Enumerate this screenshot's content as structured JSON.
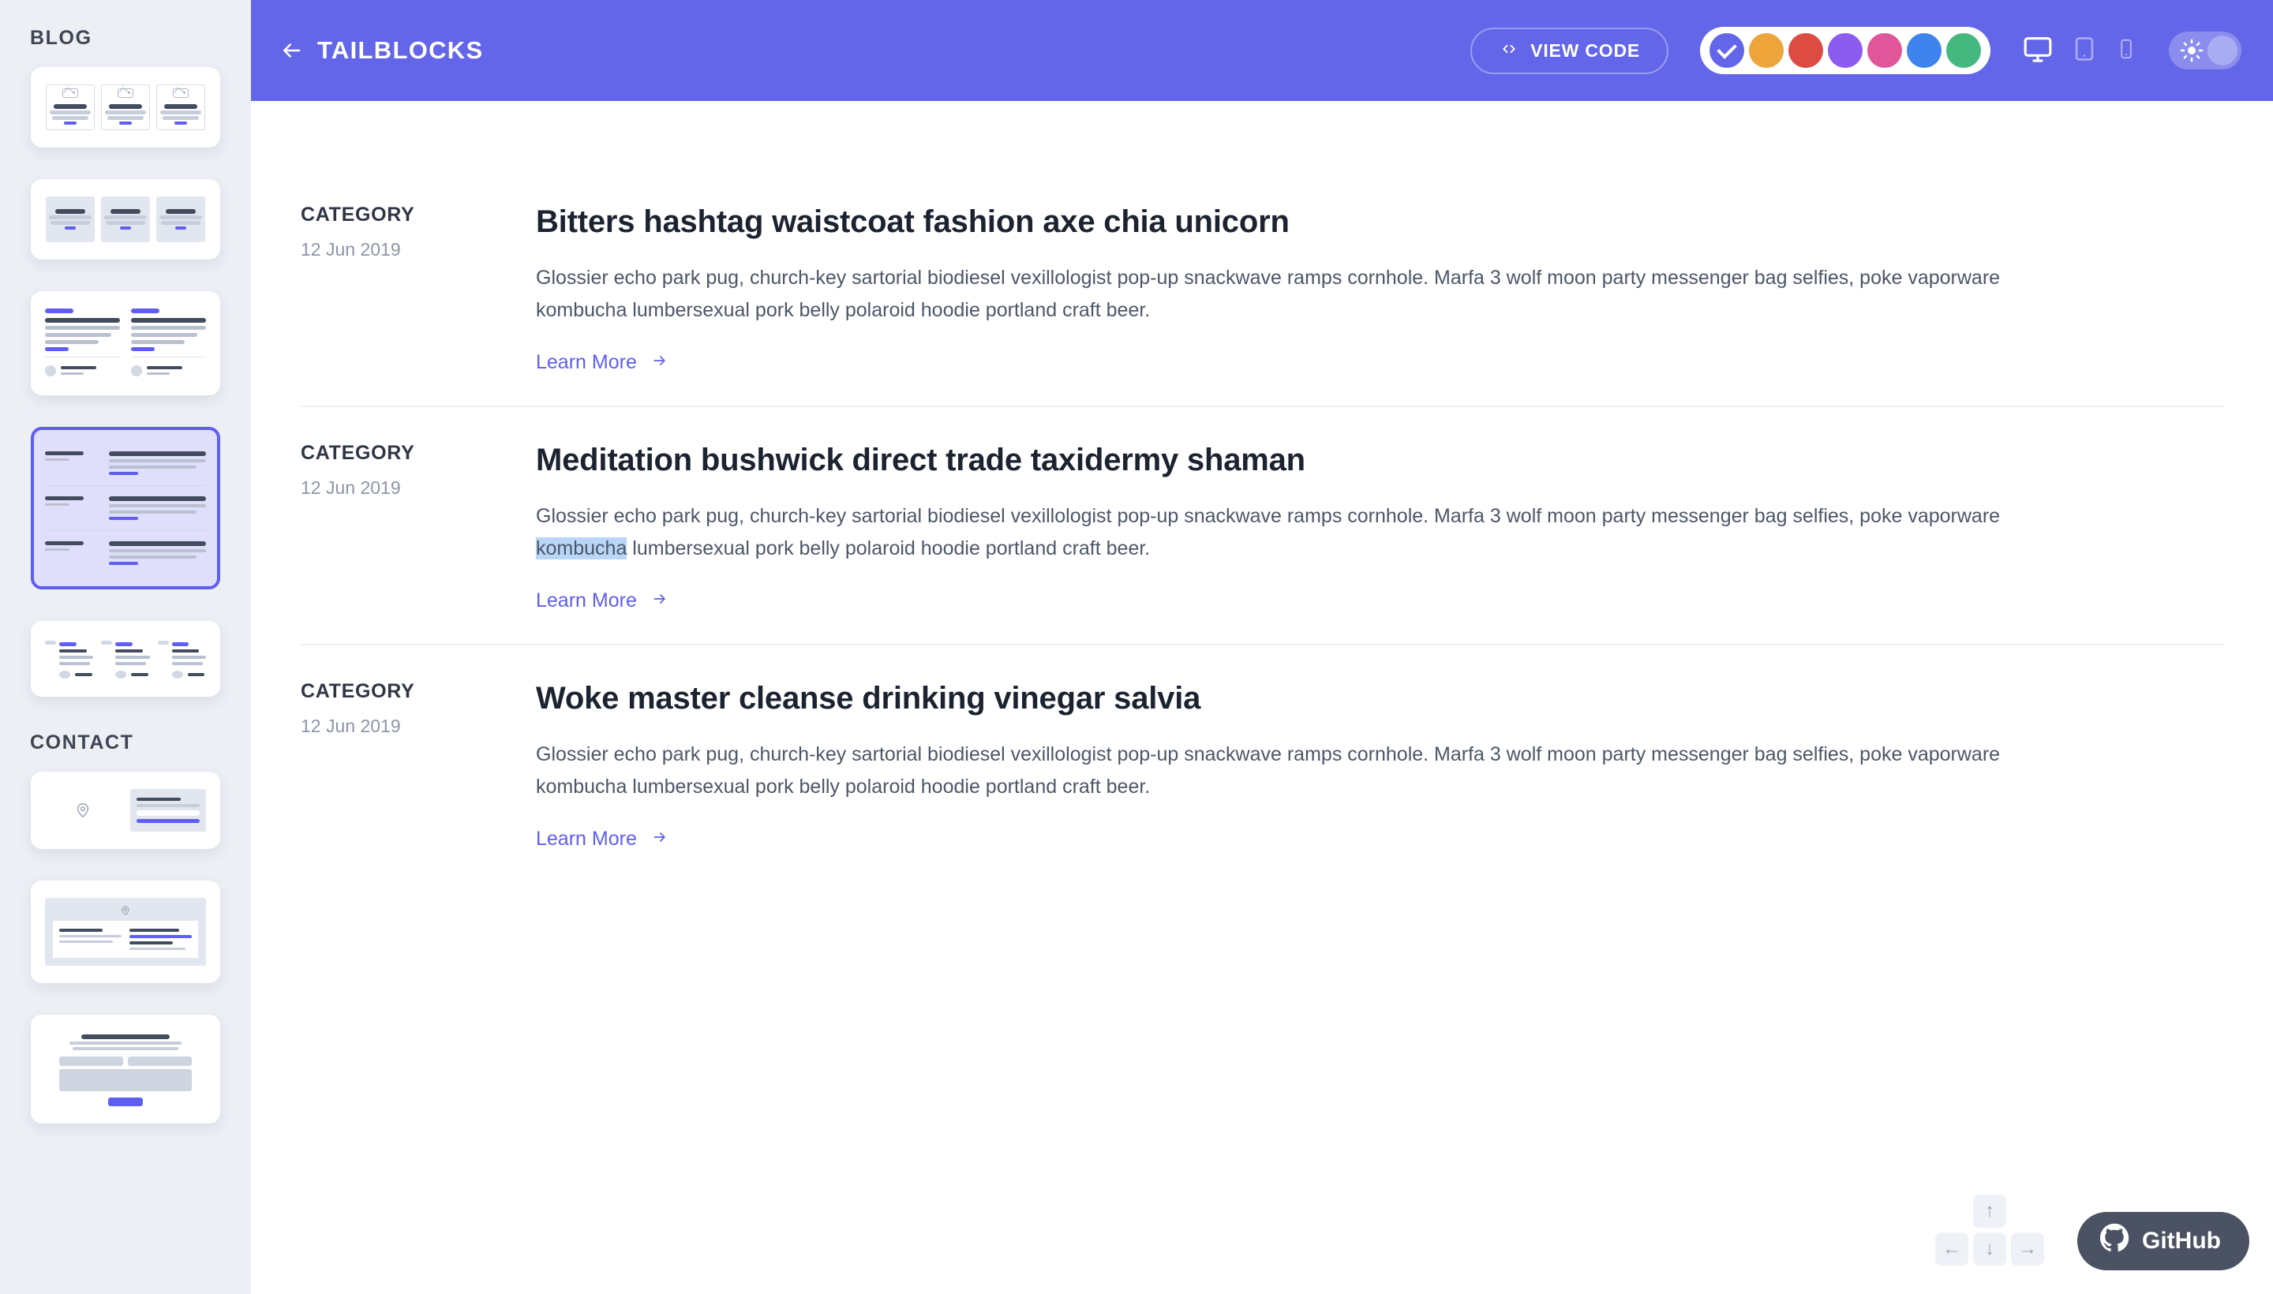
{
  "sidebar": {
    "sections": [
      {
        "title": "BLOG",
        "thumbnails": [
          "blog-3-card-grid",
          "blog-3-column-cards",
          "blog-2-column-author",
          "blog-list-rows-selected",
          "blog-3-column-avatars"
        ]
      },
      {
        "title": "CONTACT",
        "thumbnails": [
          "contact-map-form",
          "contact-map-card-form",
          "contact-centered-form"
        ]
      }
    ],
    "selected_thumbnail_index": 3
  },
  "header": {
    "back_icon": "arrow-left-icon",
    "title": "TAILBLOCKS",
    "view_code_label": "VIEW CODE",
    "view_code_icon": "code-brackets-icon",
    "swatches": [
      {
        "name": "indigo",
        "color": "#6366e8",
        "active": true
      },
      {
        "name": "amber",
        "color": "#eda53b",
        "active": false
      },
      {
        "name": "red",
        "color": "#dd4c43",
        "active": false
      },
      {
        "name": "purple",
        "color": "#8c5cf0",
        "active": false
      },
      {
        "name": "pink",
        "color": "#e1559b",
        "active": false
      },
      {
        "name": "blue",
        "color": "#3f84ee",
        "active": false
      },
      {
        "name": "green",
        "color": "#45b880",
        "active": false
      }
    ],
    "devices": [
      {
        "name": "desktop-icon",
        "active": true
      },
      {
        "name": "tablet-icon",
        "active": false
      },
      {
        "name": "mobile-icon",
        "active": false
      }
    ],
    "theme_toggle": {
      "icon": "sun-icon",
      "state": "light"
    }
  },
  "articles": [
    {
      "category": "CATEGORY",
      "date": "12 Jun 2019",
      "headline": "Bitters hashtag waistcoat fashion axe chia unicorn",
      "body_part1": "Glossier echo park pug, church-key sartorial biodiesel vexillologist pop-up snackwave ramps cornhole. Marfa 3 wolf moon party messenger bag selfies, poke vaporware ",
      "body_highlight": "kombucha",
      "body_part2": " lumbersexual pork belly polaroid hoodie portland craft beer.",
      "highlighted": false,
      "learn_more": "Learn More",
      "learn_more_icon": "arrow-right-icon"
    },
    {
      "category": "CATEGORY",
      "date": "12 Jun 2019",
      "headline": "Meditation bushwick direct trade taxidermy shaman",
      "body_part1": "Glossier echo park pug, church-key sartorial biodiesel vexillologist pop-up snackwave ramps cornhole. Marfa 3 wolf moon party messenger bag selfies, poke vaporware ",
      "body_highlight": "kombucha",
      "body_part2": " lumbersexual pork belly polaroid hoodie portland craft beer.",
      "highlighted": true,
      "learn_more": "Learn More",
      "learn_more_icon": "arrow-right-icon"
    },
    {
      "category": "CATEGORY",
      "date": "12 Jun 2019",
      "headline": "Woke master cleanse drinking vinegar salvia",
      "body_part1": "Glossier echo park pug, church-key sartorial biodiesel vexillologist pop-up snackwave ramps cornhole. Marfa 3 wolf moon party messenger bag selfies, poke vaporware ",
      "body_highlight": "kombucha",
      "body_part2": " lumbersexual pork belly polaroid hoodie portland craft beer.",
      "highlighted": false,
      "learn_more": "Learn More",
      "learn_more_icon": "arrow-right-icon"
    }
  ],
  "navpad": {
    "up": "↑",
    "left": "←",
    "down": "↓",
    "right": "→"
  },
  "github": {
    "label": "GitHub",
    "icon": "github-icon"
  },
  "colors": {
    "accent": "#5f5ef0",
    "header_bg": "#6366e8",
    "selection_highlight": "#b8d6f7",
    "page_bg": "#eceff4",
    "text_dark": "#1c2330",
    "text_body": "#4d5668",
    "text_muted": "#8d95a8",
    "github_bg": "#4a5263"
  }
}
